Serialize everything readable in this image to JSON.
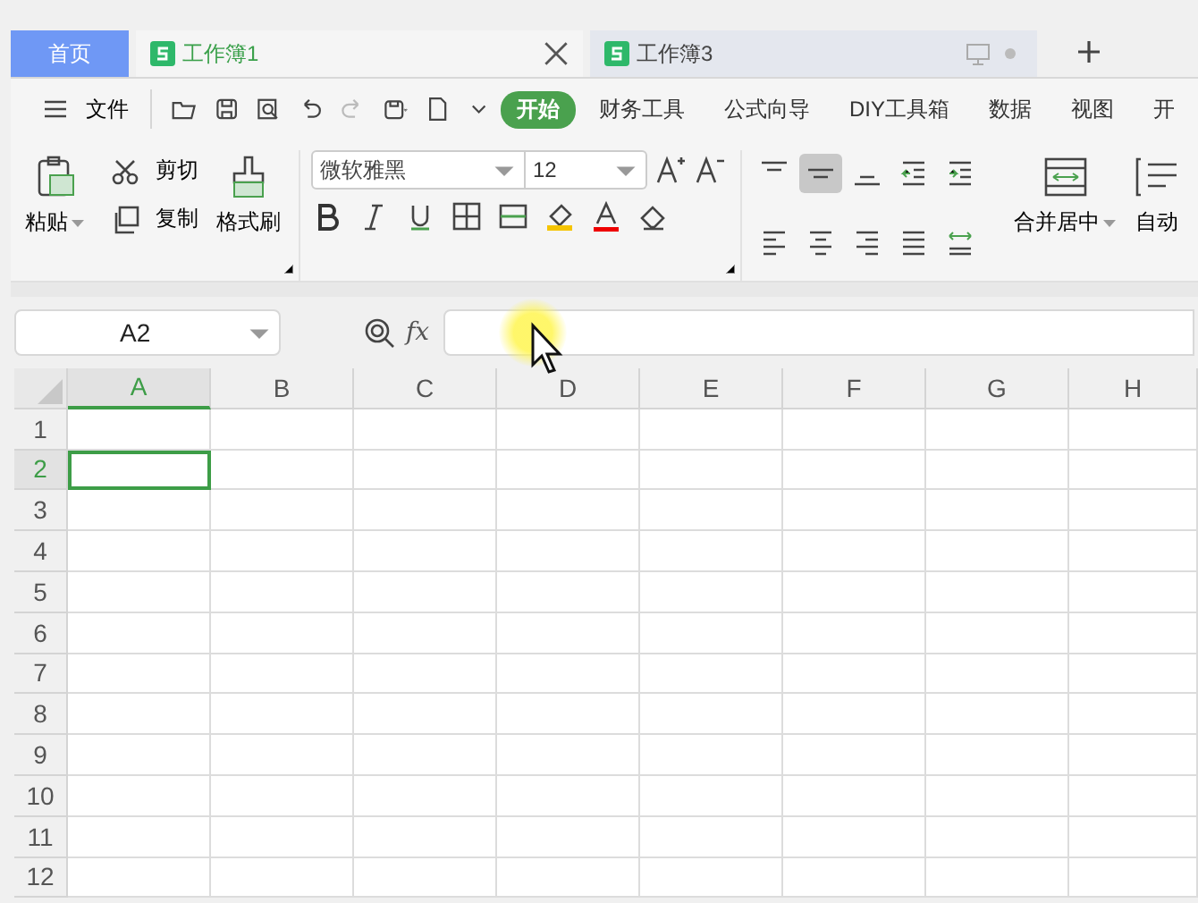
{
  "tabs": [
    {
      "label": "首页",
      "kind": "home",
      "selected": false
    },
    {
      "label": "工作簿1",
      "kind": "doc",
      "selected": true
    },
    {
      "label": "工作簿3",
      "kind": "doc",
      "selected": false
    }
  ],
  "menu": {
    "file": "文件",
    "ribbon_tabs": [
      {
        "label": "开始",
        "selected": true
      },
      {
        "label": "财务工具",
        "selected": false
      },
      {
        "label": "公式向导",
        "selected": false
      },
      {
        "label": "DIY工具箱",
        "selected": false
      },
      {
        "label": "数据",
        "selected": false
      },
      {
        "label": "视图",
        "selected": false
      },
      {
        "label": "开",
        "selected": false
      }
    ]
  },
  "ribbon": {
    "paste": "粘贴",
    "cut": "剪切",
    "copy": "复制",
    "format_painter": "格式刷",
    "font_name": "微软雅黑",
    "font_size": "12",
    "merge": "合并居中",
    "wrap": "自动",
    "align_buttons": [
      {
        "selected": false
      },
      {
        "selected": true
      },
      {
        "selected": false
      },
      {
        "selected": false
      },
      {
        "selected": false
      },
      {
        "selected": false
      },
      {
        "selected": false
      },
      {
        "selected": false
      },
      {
        "selected": false
      },
      {
        "selected": false
      }
    ]
  },
  "formula_bar": {
    "name_box": "A2",
    "fx": "fx"
  },
  "sheet": {
    "columns": [
      {
        "label": "A",
        "selected": true
      },
      {
        "label": "B",
        "selected": false
      },
      {
        "label": "C",
        "selected": false
      },
      {
        "label": "D",
        "selected": false
      },
      {
        "label": "E",
        "selected": false
      },
      {
        "label": "F",
        "selected": false
      },
      {
        "label": "G",
        "selected": false
      },
      {
        "label": "H",
        "selected": false
      }
    ],
    "rows": [
      {
        "label": "1",
        "selected": false
      },
      {
        "label": "2",
        "selected": true
      },
      {
        "label": "3",
        "selected": false
      },
      {
        "label": "4",
        "selected": false
      },
      {
        "label": "5",
        "selected": false
      },
      {
        "label": "6",
        "selected": false
      },
      {
        "label": "7",
        "selected": false
      },
      {
        "label": "8",
        "selected": false
      },
      {
        "label": "9",
        "selected": false
      },
      {
        "label": "10",
        "selected": false
      },
      {
        "label": "11",
        "selected": false
      },
      {
        "label": "12",
        "selected": false
      }
    ]
  }
}
